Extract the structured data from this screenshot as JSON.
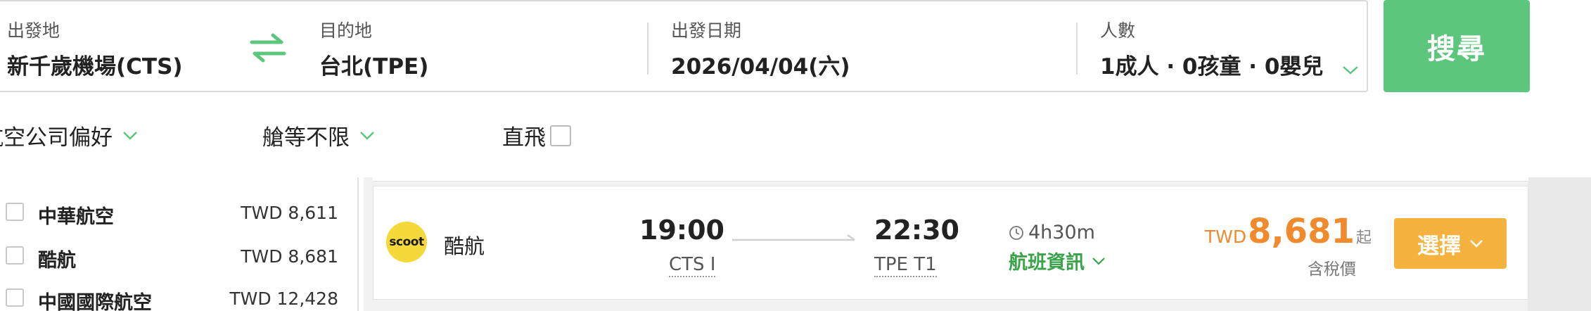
{
  "search": {
    "origin_label": "出發地",
    "origin_value": "新千歲機場(CTS)",
    "destination_label": "目的地",
    "destination_value": "台北(TPE)",
    "date_label": "出發日期",
    "date_value": "2026/04/04(六)",
    "pax_label": "人數",
    "pax_value": "1成人 · 0孩童 · 0嬰兒",
    "search_button": "搜尋"
  },
  "filters": {
    "airline_pref": "航空公司偏好",
    "cabin": "艙等不限",
    "direct": "直飛"
  },
  "airline_list": [
    {
      "name": "中華航空",
      "price": "TWD 8,611"
    },
    {
      "name": "酷航",
      "price": "TWD 8,681"
    },
    {
      "name": "中國國際航空",
      "price": "TWD 12,428"
    }
  ],
  "result": {
    "airline_logo_text": "scoot",
    "airline_name": "酷航",
    "dep_time": "19:00",
    "dep_airport": "CTS I",
    "arr_time": "22:30",
    "arr_airport": "TPE T1",
    "duration": "4h30m",
    "flight_info": "航班資訊",
    "currency": "TWD",
    "price": "8,681",
    "price_suffix": "起",
    "tax_note": "含稅價",
    "select_button": "選擇"
  },
  "colors": {
    "accent_green": "#5cc77c",
    "link_green": "#3aa34a",
    "price_orange": "#f08a2c",
    "select_yellow": "#f5b23e",
    "logo_yellow": "#f5d93a"
  },
  "icons": [
    "swap-arrows-icon",
    "chevron-down-icon",
    "clock-icon",
    "arrow-right-icon"
  ]
}
